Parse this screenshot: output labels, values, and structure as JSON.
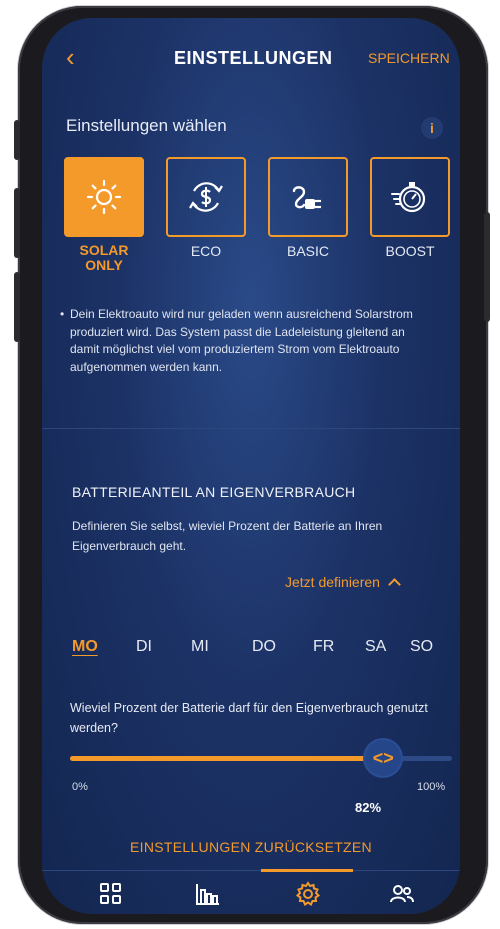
{
  "header": {
    "title": "EINSTELLUNGEN",
    "save_label": "SPEICHERN"
  },
  "settings": {
    "choose_label": "Einstellungen wählen",
    "info_icon": "i",
    "modes": [
      {
        "label": "SOLAR\nONLY",
        "icon": "sun-icon",
        "active": true
      },
      {
        "label": "ECO",
        "icon": "eco-dollar-icon",
        "active": false
      },
      {
        "label": "BASIC",
        "icon": "plug-icon",
        "active": false
      },
      {
        "label": "BOOST",
        "icon": "stopwatch-icon",
        "active": false
      }
    ],
    "description": "Dein Elektroauto wird nur geladen wenn ausreichend Solarstrom produziert wird. Das System passt die Ladeleistung gleitend an damit möglichst viel vom produziertem Strom vom Elektroauto aufgenommen werden kann."
  },
  "battery": {
    "title": "BATTERIEANTEIL AN EIGENVERBRAUCH",
    "description": "Definieren Sie selbst, wieviel Prozent der Batterie an Ihren Eigenverbrauch geht.",
    "define_label": "Jetzt definieren",
    "days": [
      "MO",
      "DI",
      "MI",
      "DO",
      "FR",
      "SA",
      "SO"
    ],
    "active_day": "MO",
    "question": "Wieviel Prozent der Batterie darf für den Eigenverbrauch genutzt werden?",
    "slider": {
      "value_percent": 82,
      "value_label": "82%",
      "min_label": "0%",
      "max_label": "100%",
      "thumb_symbol": "<>"
    },
    "reset_label": "EINSTELLUNGEN ZURÜCKSETZEN"
  },
  "nav": {
    "items": [
      {
        "icon": "grid-icon",
        "active": false
      },
      {
        "icon": "bar-chart-icon",
        "active": false
      },
      {
        "icon": "gear-icon",
        "active": true
      },
      {
        "icon": "users-icon",
        "active": false
      }
    ]
  },
  "colors": {
    "accent": "#f39a2b",
    "background": "#1c3266"
  }
}
